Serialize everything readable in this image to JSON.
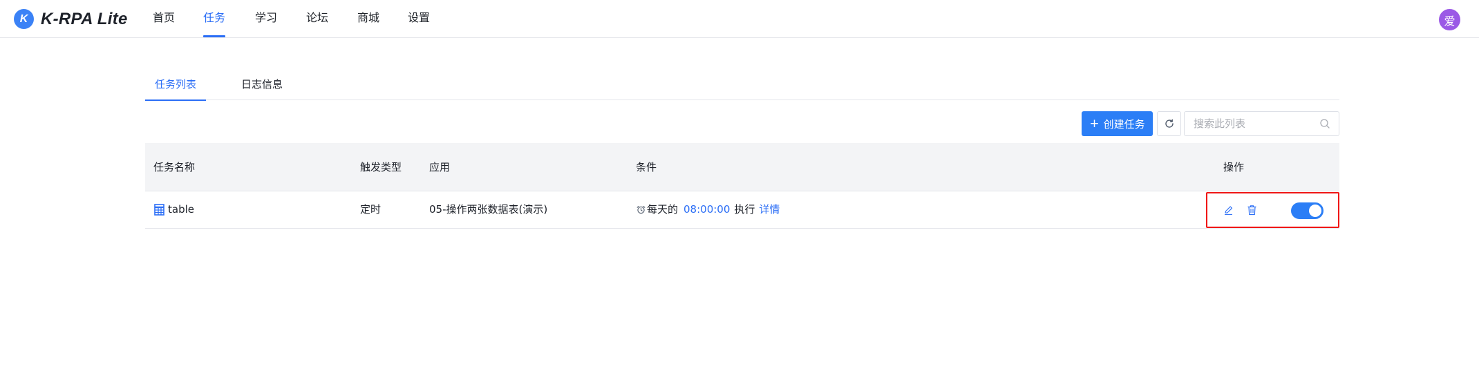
{
  "app": {
    "logo_letter": "K",
    "name": "K-RPA Lite",
    "accent_color": "#2b6ef6"
  },
  "nav": {
    "items": [
      {
        "label": "首页",
        "active": false
      },
      {
        "label": "任务",
        "active": true
      },
      {
        "label": "学习",
        "active": false
      },
      {
        "label": "论坛",
        "active": false
      },
      {
        "label": "商城",
        "active": false
      },
      {
        "label": "设置",
        "active": false
      }
    ],
    "avatar_text": "爱"
  },
  "tabs": [
    {
      "label": "任务列表",
      "active": true
    },
    {
      "label": "日志信息",
      "active": false
    }
  ],
  "toolbar": {
    "create_label": "创建任务",
    "create_icon": "plus-icon",
    "refresh_icon": "refresh-icon",
    "search_placeholder": "搜索此列表",
    "search_value": "",
    "search_icon": "search-icon"
  },
  "table": {
    "columns": [
      "任务名称",
      "触发类型",
      "应用",
      "条件",
      "操作"
    ],
    "rows": [
      {
        "name": "table",
        "name_icon": "table-icon",
        "trigger": "定时",
        "app": "05-操作两张数据表(演示)",
        "condition": {
          "icon": "alarm-clock-icon",
          "prefix": "每天的",
          "time": "08:00:00",
          "suffix": "执行",
          "detail_link": "详情"
        },
        "actions": {
          "edit_icon": "edit-icon",
          "delete_icon": "trash-icon",
          "enabled": true
        }
      }
    ]
  }
}
